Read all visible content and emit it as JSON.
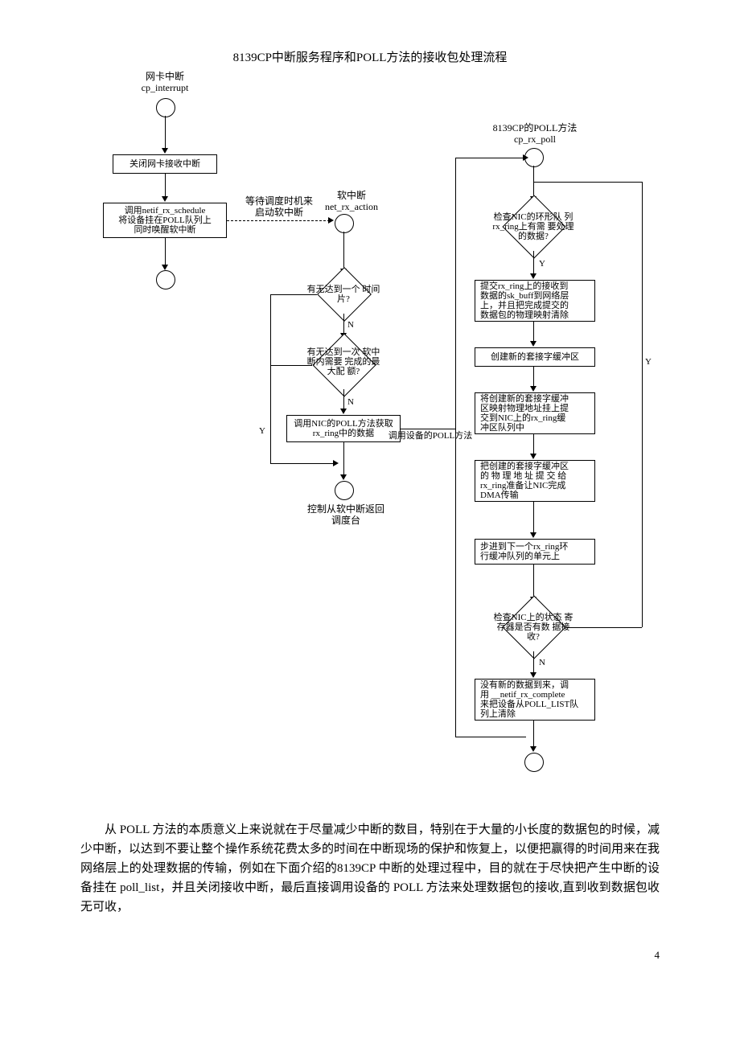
{
  "title": "8139CP中断服务程序和POLL方法的接收包处理流程",
  "labels": {
    "nic_interrupt_title": "网卡中断",
    "nic_interrupt_func": "cp_interrupt",
    "softirq_wait": "等待调度时机来\n启动软中断",
    "softirq_title": "软中断",
    "softirq_func": "net_rx_action",
    "poll_title": "8139CP的POLL方法",
    "poll_func": "cp_rx_poll",
    "call_poll": "调用设备的POLL方法"
  },
  "boxes": {
    "close_rx": "关闭网卡接收中断",
    "netif_rx_schedule": "调用netif_rx_schedule\n将设备挂在POLL队列上\n同时唤醒软中断",
    "call_nic_poll": "调用NIC的POLL方法获取\nrx_ring中的数据",
    "softirq_return": "控制从软中断返回\n调度台",
    "submit_rx_ring": "提交rx_ring上的接收到\n数据的sk_buff到网络层\n上，并且把完成提交的\n数据包的物理映射清除",
    "create_skb": "创建新的套接字缓冲区",
    "map_skb": "将创建新的套接字缓冲\n区映射物理地址挂上提\n交到NIC上的rx_ring缓\n冲区队列中",
    "submit_phys": "把创建的套接字缓冲区\n的 物 理 地 址 提 交 给\nrx_ring准备让NIC完成\nDMA传输",
    "step_next": "步进到下一个rx_ring环\n行缓冲队列的单元上",
    "no_new_data": "没有新的数据到来，调\n用 __netif_rx_complete\n来把设备从POLL_LIST队\n列上清除"
  },
  "diamonds": {
    "timeslice": "有无达到一个\n时间片?",
    "max_quota": "有无达到一次\n软中断内需要\n完成的最大配\n额?",
    "check_rx_ring": "检查NIC的环形队\n列rx_ring上有需\n要处理的数据?",
    "check_status": "检查NIC上的状态\n寄存器是否有数\n据接收?"
  },
  "edges": {
    "Y": "Y",
    "N": "N"
  },
  "paragraph": "从 POLL 方法的本质意义上来说就在于尽量减少中断的数目，特别在于大量的小长度的数据包的时候，减少中断，以达到不要让整个操作系统花费太多的时间在中断现场的保护和恢复上，以便把赢得的时间用来在我网络层上的处理数据的传输，例如在下面介绍的8139CP 中断的处理过程中，目的就在于尽快把产生中断的设备挂在 poll_list，并且关闭接收中断，最后直接调用设备的 POLL 方法来处理数据包的接收,直到收到数据包收无可收，",
  "pageNumber": "4"
}
